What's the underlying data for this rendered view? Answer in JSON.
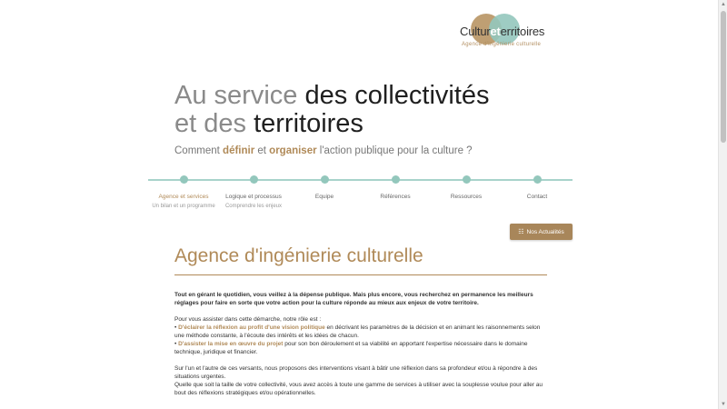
{
  "logo": {
    "word_start": "Cultur",
    "word_mid": "et",
    "word_end": "erritoires",
    "tagline": "Agence d'ingénierie culturelle",
    "colors": {
      "gold": "#bf9f73",
      "teal": "#93c7bc"
    }
  },
  "hero": {
    "title_line1_light": "Au service ",
    "title_line1_dark": "des collectivités",
    "title_line2_light": "et des ",
    "title_line2_dark": "territoires",
    "subtitle_part1": "Comment ",
    "subtitle_hl1": "définir",
    "subtitle_part2": " et ",
    "subtitle_hl2": "organiser",
    "subtitle_part3": " l'action publique pour la culture ?"
  },
  "nav": {
    "items": [
      {
        "label": "Agence et services",
        "sublabel": "Un bilan et un programme"
      },
      {
        "label": "Logique et processus",
        "sublabel": "Comprendre les enjeux"
      },
      {
        "label": "Equipe",
        "sublabel": ""
      },
      {
        "label": "Références",
        "sublabel": ""
      },
      {
        "label": "Ressources",
        "sublabel": ""
      },
      {
        "label": "Contact",
        "sublabel": ""
      }
    ]
  },
  "news_button": {
    "label": "Nos Actualités",
    "icon": "news-icon"
  },
  "section": {
    "title": "Agence d'ingénierie culturelle",
    "intro": "Tout en gérant le quotidien, vous veillez à la dépense publique. Mais plus encore, vous recherchez en permanence les meilleurs réglages pour faire en sorte que votre action pour la culture réponde au mieux aux enjeux de votre territoire.",
    "assist_intro": "Pour vous assister dans cette démarche, notre rôle est :",
    "bullet1_hl": "D'éclairer la réflexion au profit d'une vision politique",
    "bullet1_rest": " en décrivant les paramètres de la décision et en animant les raisonnements selon une méthode constante, à l'écoute des intérêts et les idées de chacun.",
    "bullet2_hl": "D'assister la mise en œuvre du projet",
    "bullet2_rest": " pour son bon déroulement et sa viabilité en apportant l'expertise nécessaire dans le domaine technique, juridique et financier.",
    "para3_line1": "Sur l'un et l'autre de ces versants, nous proposons des interventions visant à bâtir une réflexion dans sa profondeur et/ou à répondre à des situations urgentes.",
    "para3_line2": "Quelle que soit la taille de votre collectivité, vous avez accès à toute une gamme de services à utiliser avec la souplesse voulue pour aller au bout des réflexions stratégiques et/ou opérationnelles."
  }
}
